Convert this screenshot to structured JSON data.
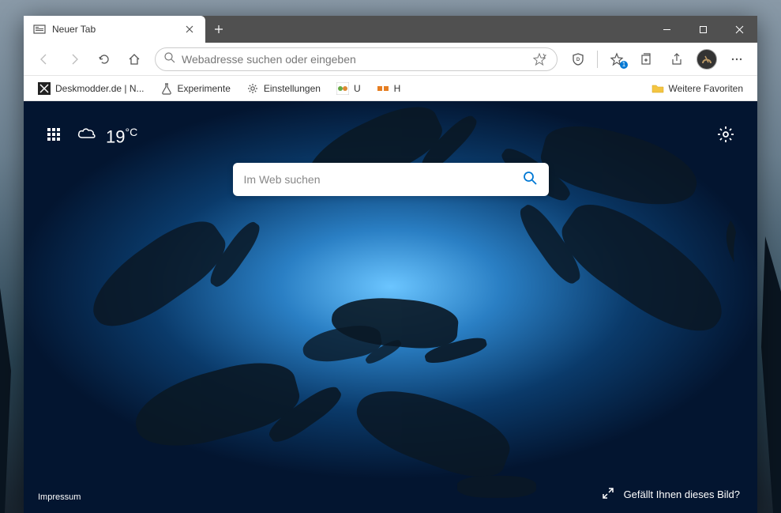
{
  "tab": {
    "title": "Neuer Tab"
  },
  "address": {
    "placeholder": "Webadresse suchen oder eingeben"
  },
  "bookmarks": {
    "items": [
      {
        "label": "Deskmodder.de | N...",
        "icon": "deskmodder"
      },
      {
        "label": "Experimente",
        "icon": "flask"
      },
      {
        "label": "Einstellungen",
        "icon": "gear"
      },
      {
        "label": "U",
        "icon": "u"
      },
      {
        "label": "H",
        "icon": "h"
      }
    ],
    "overflow": "Weitere Favoriten"
  },
  "weather": {
    "temp": "19",
    "unit": "°C"
  },
  "search": {
    "placeholder": "Im Web suchen"
  },
  "footer": {
    "impressum": "Impressum",
    "like_image": "Gefällt Ihnen dieses Bild?"
  },
  "favorites_badge": "1"
}
